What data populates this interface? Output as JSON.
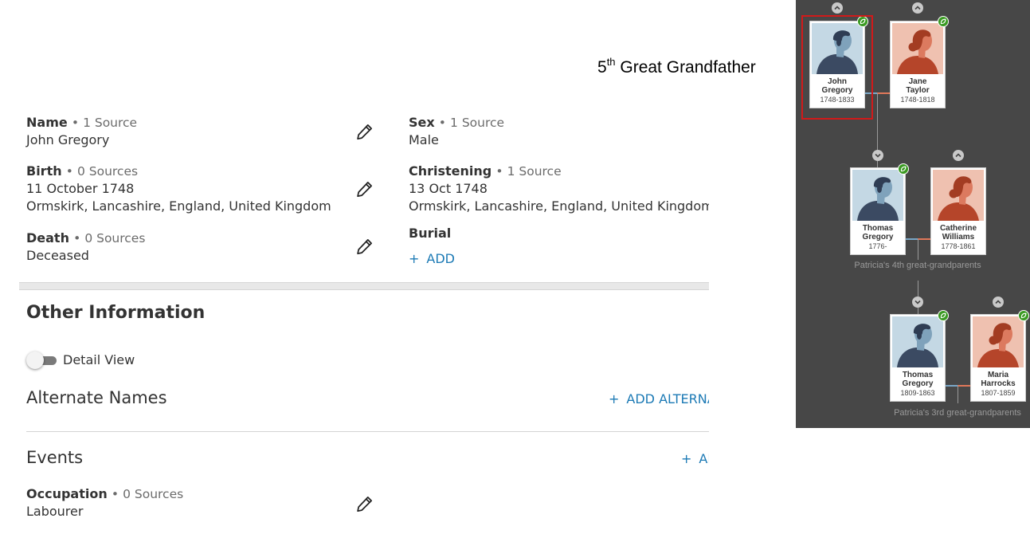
{
  "annotation": {
    "ordinal_number": "5",
    "ordinal_suffix": "th",
    "text": "Great Grandfather"
  },
  "facts": {
    "name": {
      "label": "Name",
      "sources": "1 Source",
      "value": "John Gregory"
    },
    "sex": {
      "label": "Sex",
      "sources": "1 Source",
      "value": "Male"
    },
    "birth": {
      "label": "Birth",
      "sources": "0 Sources",
      "date": "11 October 1748",
      "place": "Ormskirk, Lancashire, England, United Kingdom"
    },
    "christening": {
      "label": "Christening",
      "sources": "1 Source",
      "date": "13 Oct 1748",
      "place": "Ormskirk, Lancashire, England, United Kingdom"
    },
    "death": {
      "label": "Death",
      "sources": "0 Sources",
      "value": "Deceased"
    },
    "burial": {
      "label": "Burial",
      "add_label": "ADD"
    }
  },
  "separator": "•",
  "plus": "+",
  "other_information": {
    "heading": "Other Information",
    "detail_view_label": "Detail View",
    "detail_view_on": false,
    "alternate_names": {
      "heading": "Alternate Names",
      "add_label": "ADD ALTERNATE NAME"
    },
    "events": {
      "heading": "Events",
      "add_label": "ADD",
      "occupation": {
        "label": "Occupation",
        "sources": "0 Sources",
        "value": "Labourer"
      }
    }
  },
  "tree": {
    "people": [
      {
        "first": "John",
        "last": "Gregory",
        "dates": "1748-1833",
        "gender": "male",
        "hint_leaf": true,
        "highlighted": true
      },
      {
        "first": "Jane",
        "last": "Taylor",
        "dates": "1748-1818",
        "gender": "female",
        "hint_leaf": true
      },
      {
        "first": "Thomas",
        "last": "Gregory",
        "dates": "1776-",
        "gender": "male",
        "hint_leaf": true
      },
      {
        "first": "Catherine",
        "last": "Williams",
        "dates": "1778-1861",
        "gender": "female",
        "hint_leaf": false
      },
      {
        "first": "Thomas",
        "last": "Gregory",
        "dates": "1809-1863",
        "gender": "male",
        "hint_leaf": true
      },
      {
        "first": "Maria",
        "last": "Harrocks",
        "dates": "1807-1859",
        "gender": "female",
        "hint_leaf": true
      }
    ],
    "generation_labels": [
      "Patricia's 4th great-grandparents",
      "Patricia's 3rd great-grandparents"
    ]
  },
  "colors": {
    "link": "#1c7ab5",
    "tree_background": "#474747",
    "highlight": "#d11a1a",
    "hint_leaf": "#3a9a22",
    "male_connector": "#7aa6c6",
    "female_connector": "#e0785a"
  },
  "icons": {
    "edit": "pencil-icon",
    "expand_up": "chevron-up-icon",
    "expand_down": "chevron-down-icon",
    "hint": "leaf-hint-icon",
    "male_portrait": "male-silhouette-icon",
    "female_portrait": "female-silhouette-icon"
  }
}
